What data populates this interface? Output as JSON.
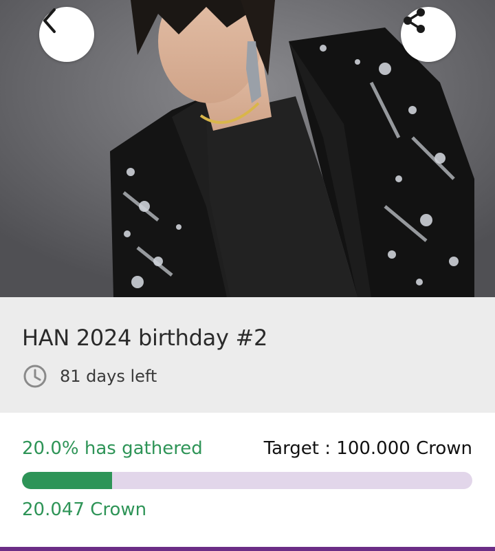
{
  "campaign": {
    "title": "HAN 2024 birthday #2",
    "days_left": "81 days left"
  },
  "funding": {
    "gathered_label": "20.0% has gathered",
    "target_label": "Target : 100.000 Crown",
    "amount_label": "20.047 Crown",
    "progress_fraction": 0.2
  },
  "hero": {
    "back_icon": "chevron-left-icon",
    "share_icon": "share-icon"
  },
  "colors": {
    "accent_green": "#2e9457",
    "track": "#e2d6ea",
    "info_bg": "#ececec",
    "bottom_rule": "#6b2d86"
  }
}
